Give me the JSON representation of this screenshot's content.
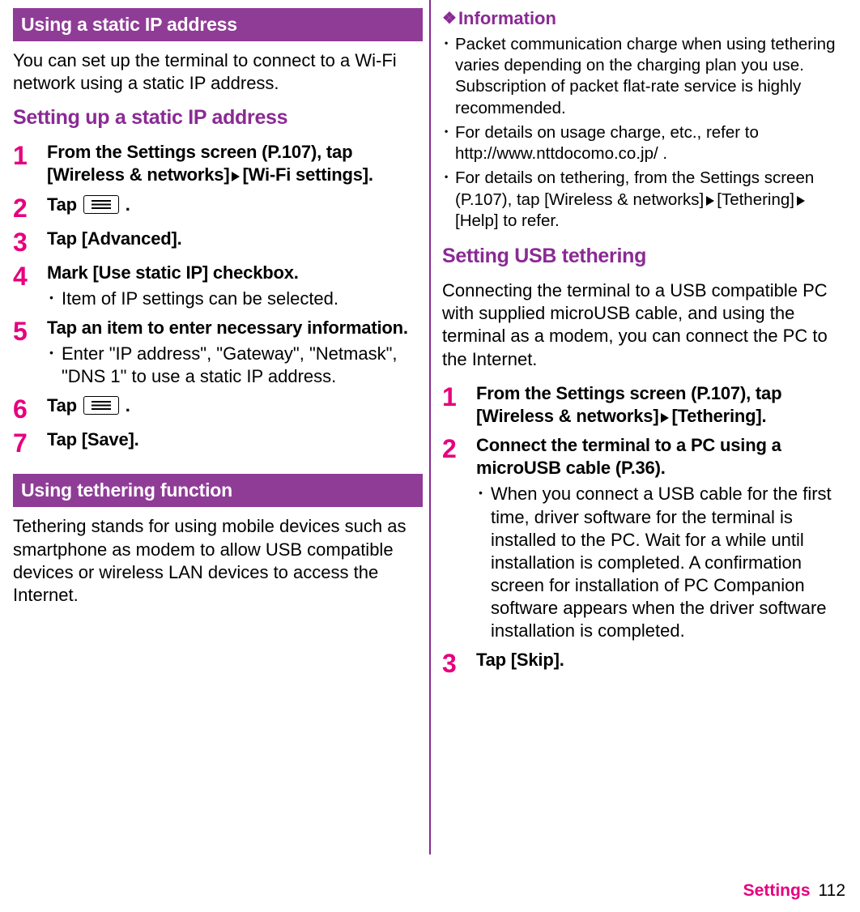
{
  "left": {
    "bar1": "Using a static IP address",
    "intro1": "You can set up the terminal to connect to a Wi-Fi network using a static IP address.",
    "sub1": "Setting up a static IP address",
    "steps1": [
      {
        "n": "1",
        "title_parts": [
          "From the Settings screen (P.107), tap [Wireless & networks]",
          "[Wi-Fi settings]."
        ],
        "has_tri": true
      },
      {
        "n": "2",
        "title_parts": [
          "Tap "
        ],
        "has_menu": true,
        "tail": " ."
      },
      {
        "n": "3",
        "title_parts": [
          "Tap [Advanced]."
        ]
      },
      {
        "n": "4",
        "title_parts": [
          "Mark [Use static IP] checkbox."
        ],
        "bullets": [
          "Item of IP settings can be selected."
        ]
      },
      {
        "n": "5",
        "title_parts": [
          "Tap an item to enter necessary information."
        ],
        "bullets": [
          "Enter \"IP address\", \"Gateway\", \"Netmask\", \"DNS 1\" to use a static IP address."
        ]
      },
      {
        "n": "6",
        "title_parts": [
          "Tap "
        ],
        "has_menu": true,
        "tail": " ."
      },
      {
        "n": "7",
        "title_parts": [
          "Tap [Save]."
        ]
      }
    ],
    "bar2": "Using tethering function",
    "intro2": "Tethering stands for using mobile devices such as smartphone as modem to allow USB compatible devices or wireless LAN devices to access the Internet."
  },
  "right": {
    "info_head": "Information",
    "info_bullets": [
      {
        "text": "Packet communication charge when using tethering varies depending on the charging plan you use. Subscription of packet flat-rate service is highly recommended."
      },
      {
        "text": "For details on usage charge, etc., refer to http://www.nttdocomo.co.jp/ ."
      },
      {
        "text_parts": [
          "For details on tethering, from the Settings screen (P.107), tap [Wireless & networks]",
          "[Tethering]",
          "[Help] to refer."
        ],
        "has_tri": true
      }
    ],
    "sub1": "Setting USB tethering",
    "intro1": "Connecting the terminal to a USB compatible PC with supplied microUSB cable, and using the terminal as a modem, you can connect the PC to the Internet.",
    "steps1": [
      {
        "n": "1",
        "title_parts": [
          "From the Settings screen (P.107), tap [Wireless & networks]",
          "[Tethering]."
        ],
        "has_tri": true
      },
      {
        "n": "2",
        "title_parts": [
          "Connect the terminal to a PC using a microUSB cable (P.36)."
        ],
        "bullets": [
          "When you connect a USB cable for the first time, driver software for the terminal is installed to the PC. Wait for a while until installation is completed. A confirmation screen for installation of PC Companion software appears when the driver software installation is completed."
        ]
      },
      {
        "n": "3",
        "title_parts": [
          "Tap [Skip]."
        ]
      }
    ]
  },
  "footer": {
    "label": "Settings",
    "page": "112"
  }
}
